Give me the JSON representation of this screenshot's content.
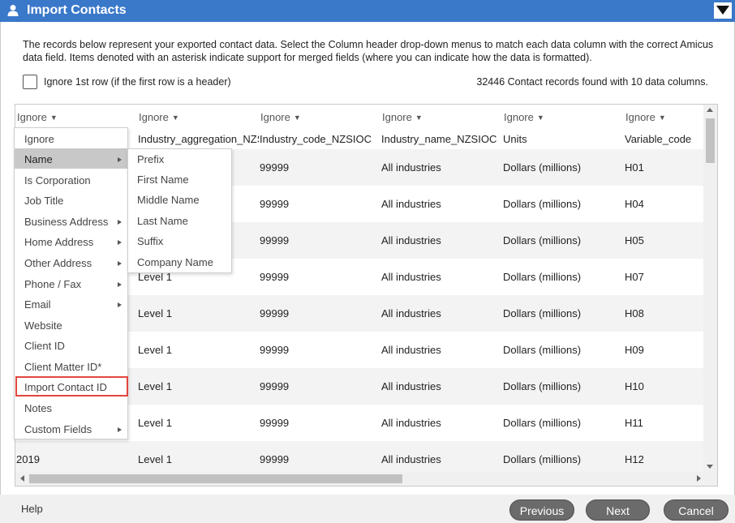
{
  "window": {
    "title": "Import Contacts"
  },
  "instructions": "The records below represent your exported contact data. Select the Column header drop-down menus to match each data column with the correct Amicus data field. Items denoted with an asterisk indicate support for merged fields (where you can indicate how the data is formatted).",
  "ignore_first_row": {
    "label": "Ignore 1st row (if the first row is a header)",
    "checked": false
  },
  "records_found": "32446 Contact records found with 10 data columns.",
  "columns": [
    "Ignore",
    "Ignore",
    "Ignore",
    "Ignore",
    "Ignore",
    "Ignore"
  ],
  "rows": [
    [
      "",
      "Industry_aggregation_NZSIOC",
      "Industry_code_NZSIOC",
      "Industry_name_NZSIOC",
      "Units",
      "Variable_code"
    ],
    [
      "",
      "",
      "99999",
      "All industries",
      "Dollars (millions)",
      "H01"
    ],
    [
      "",
      "",
      "99999",
      "All industries",
      "Dollars (millions)",
      "H04"
    ],
    [
      "",
      "",
      "99999",
      "All industries",
      "Dollars (millions)",
      "H05"
    ],
    [
      "",
      "Level 1",
      "99999",
      "All industries",
      "Dollars (millions)",
      "H07"
    ],
    [
      "",
      "Level 1",
      "99999",
      "All industries",
      "Dollars (millions)",
      "H08"
    ],
    [
      "",
      "Level 1",
      "99999",
      "All industries",
      "Dollars (millions)",
      "H09"
    ],
    [
      "",
      "Level 1",
      "99999",
      "All industries",
      "Dollars (millions)",
      "H10"
    ],
    [
      "",
      "Level 1",
      "99999",
      "All industries",
      "Dollars (millions)",
      "H11"
    ],
    [
      "2019",
      "Level 1",
      "99999",
      "All industries",
      "Dollars (millions)",
      "H12"
    ]
  ],
  "field_menu": [
    {
      "label": "Ignore",
      "submenu": false
    },
    {
      "label": "Name",
      "submenu": true,
      "active": true
    },
    {
      "label": "Is Corporation",
      "submenu": false
    },
    {
      "label": "Job Title",
      "submenu": false
    },
    {
      "label": "Business Address",
      "submenu": true
    },
    {
      "label": "Home Address",
      "submenu": true
    },
    {
      "label": "Other Address",
      "submenu": true
    },
    {
      "label": "Phone / Fax",
      "submenu": true
    },
    {
      "label": "Email",
      "submenu": true
    },
    {
      "label": "Website",
      "submenu": false
    },
    {
      "label": "Client ID",
      "submenu": false
    },
    {
      "label": "Client Matter ID*",
      "submenu": false
    },
    {
      "label": "Import Contact ID",
      "submenu": false,
      "highlighted": true
    },
    {
      "label": "Notes",
      "submenu": false
    },
    {
      "label": "Custom Fields",
      "submenu": true
    }
  ],
  "name_submenu": [
    "Prefix",
    "First Name",
    "Middle Name",
    "Last Name",
    "Suffix",
    "Company Name"
  ],
  "footer": {
    "help": "Help",
    "previous": "Previous",
    "next": "Next",
    "cancel": "Cancel"
  },
  "colors": {
    "titlebar": "#3a78c9",
    "button": "#6b6b6b",
    "highlight_outline": "#e2463f"
  },
  "icons": {
    "title": "person-icon",
    "collapse": "collapse-triangle-icon"
  }
}
